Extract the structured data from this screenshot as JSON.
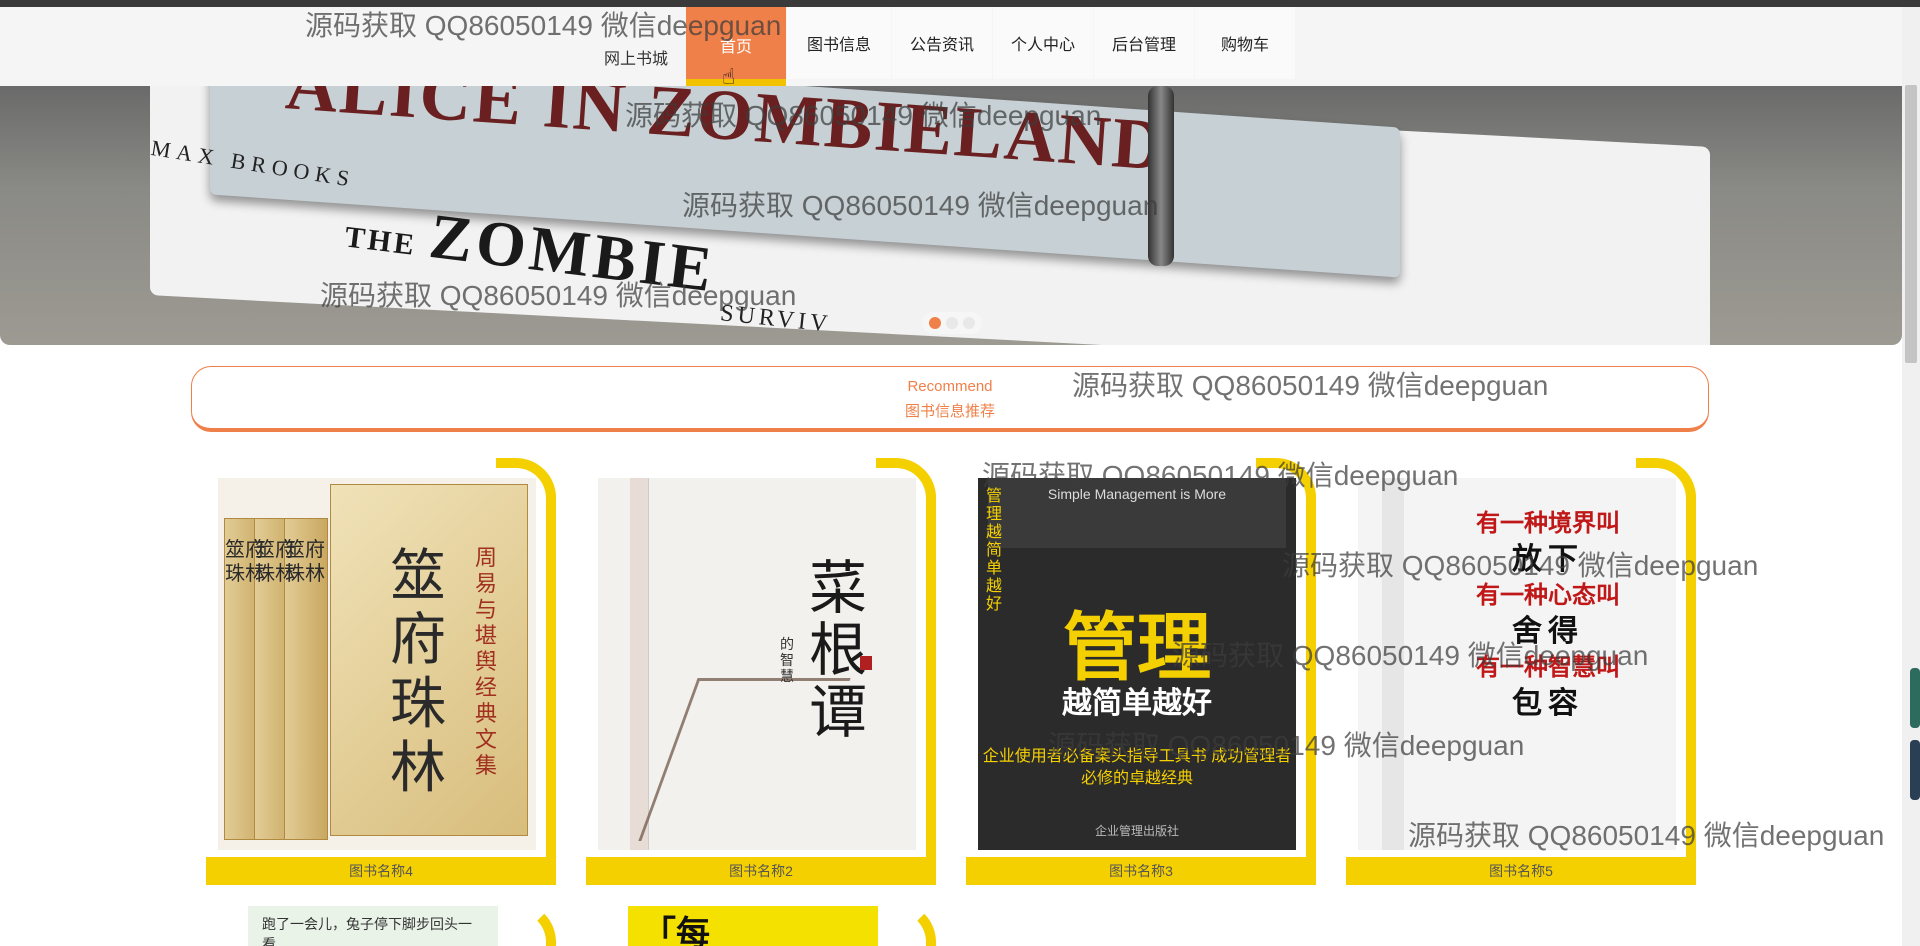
{
  "header": {
    "site_name": "网上书城",
    "nav": [
      "首页",
      "图书信息",
      "公告资讯",
      "个人中心",
      "后台管理",
      "购物车"
    ]
  },
  "banner": {
    "title_text": "ALICE IN ZOMBIELAND",
    "author_text": "MAX BROOKS",
    "subtitle_small": "THE",
    "subtitle_big": "ZOMBIE",
    "subtitle_end": "SURVIV",
    "slide_count": 3,
    "active_slide": 1
  },
  "recommend": {
    "en": "Recommend",
    "cn": "图书信息推荐"
  },
  "books": [
    {
      "name": "图书名称4",
      "cover_title": "筮府珠林",
      "cover_side": "周易与堪舆经典文集",
      "volume_titles": [
        "筮府珠林",
        "筮府珠林",
        "筮府珠林"
      ]
    },
    {
      "name": "图书名称2",
      "cover_title": "菜根谭",
      "cover_sub": "的智慧"
    },
    {
      "name": "图书名称3",
      "cover_header": "Simple Management is More",
      "cover_big": "管理",
      "cover_sub": "越简单越好",
      "cover_band": "企业使用者必备案头指导工具书 成功管理者必修的卓越经典",
      "cover_pub": "企业管理出版社",
      "cover_side": "管理越简单越好"
    },
    {
      "name": "图书名称5",
      "lines": [
        {
          "text": "有一种境界叫",
          "style": "red"
        },
        {
          "text": "放下",
          "style": "blk"
        },
        {
          "text": "有一种心态叫",
          "style": "red"
        },
        {
          "text": "舍得",
          "style": "blk"
        },
        {
          "text": "有一种智慧叫",
          "style": "red"
        },
        {
          "text": "包容",
          "style": "blk"
        }
      ]
    }
  ],
  "row2": {
    "cover_a_text": "跑了一会儿，兔子停下脚步回头一看",
    "cover_b_text": "「每"
  },
  "watermark": "源码获取 QQ86050149 微信deepguan",
  "colors": {
    "accent": "#f08049",
    "yellow": "#f5d000"
  }
}
